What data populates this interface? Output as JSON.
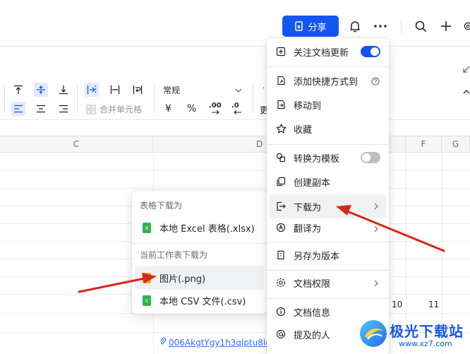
{
  "header": {
    "share_label": "分享",
    "icons": [
      "bell-icon",
      "more-icon",
      "search-icon",
      "plus-icon",
      "settings-icon"
    ]
  },
  "toolbar": {
    "number_format": "常规",
    "merge_label": "合并单元格",
    "currency_symbol": "¥",
    "percent_symbol": "%",
    "decimal_inc": ".00",
    "decimal_dec": ".0",
    "more_label": "更"
  },
  "sheet": {
    "columns": [
      "C",
      "D",
      "F",
      "G"
    ],
    "cells": {
      "r1": "10",
      "r2": "11"
    },
    "link_text": "006AkgtYgy1h3qlptu8lc"
  },
  "main_menu": {
    "items": [
      {
        "label": "关注文档更新",
        "icon": "bell-plus-icon",
        "toggle": true
      },
      {
        "label": "添加快捷方式到",
        "icon": "shortcut-icon",
        "help": true
      },
      {
        "label": "移动到",
        "icon": "move-icon"
      },
      {
        "label": "收藏",
        "icon": "star-icon"
      },
      {
        "label": "转换为模板",
        "icon": "template-icon",
        "toggle": false
      },
      {
        "label": "创建副本",
        "icon": "copy-icon"
      },
      {
        "label": "下载为",
        "icon": "download-icon",
        "submenu": true
      },
      {
        "label": "翻译为",
        "icon": "translate-icon",
        "submenu": true
      },
      {
        "label": "另存为版本",
        "icon": "version-icon"
      },
      {
        "label": "文档权限",
        "icon": "permission-icon",
        "submenu": true
      },
      {
        "label": "文档信息",
        "icon": "info-icon"
      },
      {
        "label": "提及的人",
        "icon": "mention-icon"
      }
    ],
    "accent": "#1456f0"
  },
  "download_submenu": {
    "section1_title": "表格下载为",
    "excel_label": "本地 Excel 表格(.xlsx)",
    "section2_title": "当前工作表下载为",
    "png_label": "图片(.png)",
    "csv_label": "本地 CSV 文件(.csv)"
  },
  "watermark": {
    "text": "极光下载站",
    "url": "www.xz7.com"
  }
}
